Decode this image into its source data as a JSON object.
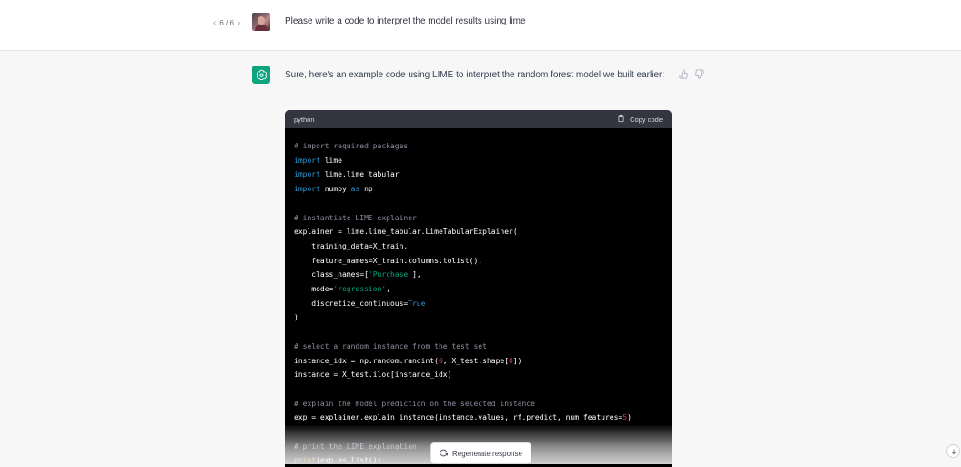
{
  "user_message": {
    "pager": {
      "prev": "‹",
      "text": "6 / 6",
      "next": "›"
    },
    "text": "Please write a code to interpret the model results using lime"
  },
  "assistant_message": {
    "text": "Sure, here's an example code using LIME to interpret the random forest model we built earlier:",
    "code_block": {
      "language": "python",
      "copy_label": "Copy code",
      "lines": [
        [
          {
            "t": "# import required packages",
            "c": "c"
          }
        ],
        [
          {
            "t": "import",
            "c": "k"
          },
          {
            "t": " lime"
          }
        ],
        [
          {
            "t": "import",
            "c": "k"
          },
          {
            "t": " lime.lime_tabular"
          }
        ],
        [
          {
            "t": "import",
            "c": "k"
          },
          {
            "t": " numpy "
          },
          {
            "t": "as",
            "c": "k"
          },
          {
            "t": " np"
          }
        ],
        [],
        [
          {
            "t": "# instantiate LIME explainer",
            "c": "c"
          }
        ],
        [
          {
            "t": "explainer = lime.lime_tabular.LimeTabularExplainer("
          }
        ],
        [
          {
            "t": "    training_data=X_train,"
          }
        ],
        [
          {
            "t": "    feature_names=X_train.columns.tolist(),"
          }
        ],
        [
          {
            "t": "    class_names=["
          },
          {
            "t": "'Purchase'",
            "c": "s"
          },
          {
            "t": "],"
          }
        ],
        [
          {
            "t": "    mode="
          },
          {
            "t": "'regression'",
            "c": "s"
          },
          {
            "t": ","
          }
        ],
        [
          {
            "t": "    discretize_continuous="
          },
          {
            "t": "True",
            "c": "k"
          }
        ],
        [
          {
            "t": ")"
          }
        ],
        [],
        [
          {
            "t": "# select a random instance from the test set",
            "c": "c"
          }
        ],
        [
          {
            "t": "instance_idx = np.random.randint("
          },
          {
            "t": "0",
            "c": "n"
          },
          {
            "t": ", X_test.shape["
          },
          {
            "t": "0",
            "c": "n"
          },
          {
            "t": "])"
          }
        ],
        [
          {
            "t": "instance = X_test.iloc[instance_idx]"
          }
        ],
        [],
        [
          {
            "t": "# explain the model prediction on the selected instance",
            "c": "c"
          }
        ],
        [
          {
            "t": "exp = explainer.explain_instance(instance.values, rf.predict, num_features="
          },
          {
            "t": "5",
            "c": "n"
          },
          {
            "t": ")"
          }
        ],
        [],
        [
          {
            "t": "# print the LIME explanation",
            "c": "c"
          }
        ],
        [
          {
            "t": "print",
            "c": "b"
          },
          {
            "t": "(exp.as_list())"
          }
        ]
      ]
    }
  },
  "regenerate_label": "Regenerate response",
  "colors": {
    "accent": "#10a37f",
    "code_bg": "#000000",
    "code_header": "#343541",
    "comment": "#8e8ea0",
    "keyword": "#2e95d3",
    "string": "#00a67d",
    "number": "#df3079",
    "builtin": "#e9950c"
  },
  "icons": [
    "chevron-left-icon",
    "chevron-right-icon",
    "user-avatar",
    "chatgpt-logo-icon",
    "thumbs-up-icon",
    "thumbs-down-icon",
    "clipboard-icon",
    "refresh-icon",
    "arrow-down-icon"
  ]
}
